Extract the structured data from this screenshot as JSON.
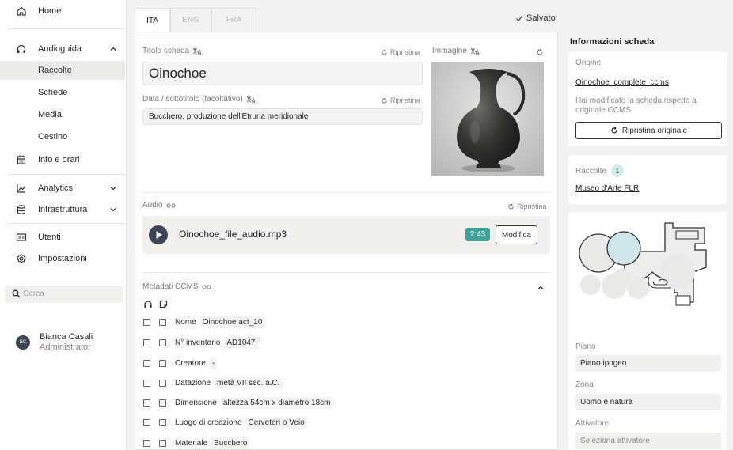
{
  "sidebar": {
    "items": [
      {
        "label": "Home",
        "icon": "home-icon"
      },
      {
        "label": "Audioguida",
        "icon": "headphones-icon"
      },
      {
        "label": "Raccolte"
      },
      {
        "label": "Schede"
      },
      {
        "label": "Media"
      },
      {
        "label": "Cestino"
      },
      {
        "label": "Info e orari",
        "icon": "calendar-icon"
      },
      {
        "label": "Analytics",
        "icon": "chart-icon"
      },
      {
        "label": "Infrastruttura",
        "icon": "database-icon"
      },
      {
        "label": "Utenti",
        "icon": "id-card-icon"
      },
      {
        "label": "Impostazioni",
        "icon": "gear-icon"
      }
    ],
    "search_placeholder": "Cerca",
    "user": {
      "initials": "BC",
      "name": "Bianca Casali",
      "role": "Administrator"
    }
  },
  "tabs": [
    "ITA",
    "ENG",
    "FRA"
  ],
  "status": "Salvato",
  "form": {
    "title_label": "Titolo scheda",
    "title_value": "Oinochoe",
    "subtitle_label": "Data / sottotitolo (facoltativo)",
    "subtitle_value": "Bucchero, produzione dell'Etruria meridionale",
    "image_label": "Immagine",
    "reset_label": "Ripristina",
    "audio_label": "Audio",
    "audio_file": "Oinochoe_file_audio.mp3",
    "audio_duration": "2:43",
    "audio_edit": "Modifica",
    "meta_label": "Metadati CCMS",
    "metadata": [
      {
        "key": "Nome",
        "value": "Oinochoe act_10"
      },
      {
        "key": "N° inventario",
        "value": "AD1047"
      },
      {
        "key": "Creatore",
        "value": "-"
      },
      {
        "key": "Datazione",
        "value": "metà VII sec. a.C."
      },
      {
        "key": "Dimensione",
        "value": "altezza 54cm x diametro 18cm"
      },
      {
        "key": "Luogo di creazione",
        "value": "Cerveteri o Veio"
      },
      {
        "key": "Materiale",
        "value": "Bucchero"
      }
    ]
  },
  "info": {
    "title": "Informazioni scheda",
    "origin_label": "Origine",
    "origin_link": "Oinochoe_complete_ccms",
    "modified_note": "Hai modificato la scheda rispetto a originale CCMS",
    "restore_button": "Ripristina originale",
    "collections_label": "Raccolte",
    "collections_count": "1",
    "collection_link": "Museo d'Arte FLR",
    "floor_label": "Piano",
    "floor_value": "Piano ipogeo",
    "zone_label": "Zona",
    "zone_value": "Uomo e natura",
    "trigger_label": "Attivatore",
    "trigger_placeholder": "Seleziona attivatore"
  },
  "colors": {
    "accent": "#3fa39a",
    "dark": "#3b4554",
    "highlight_room": "#cfe7ea"
  }
}
